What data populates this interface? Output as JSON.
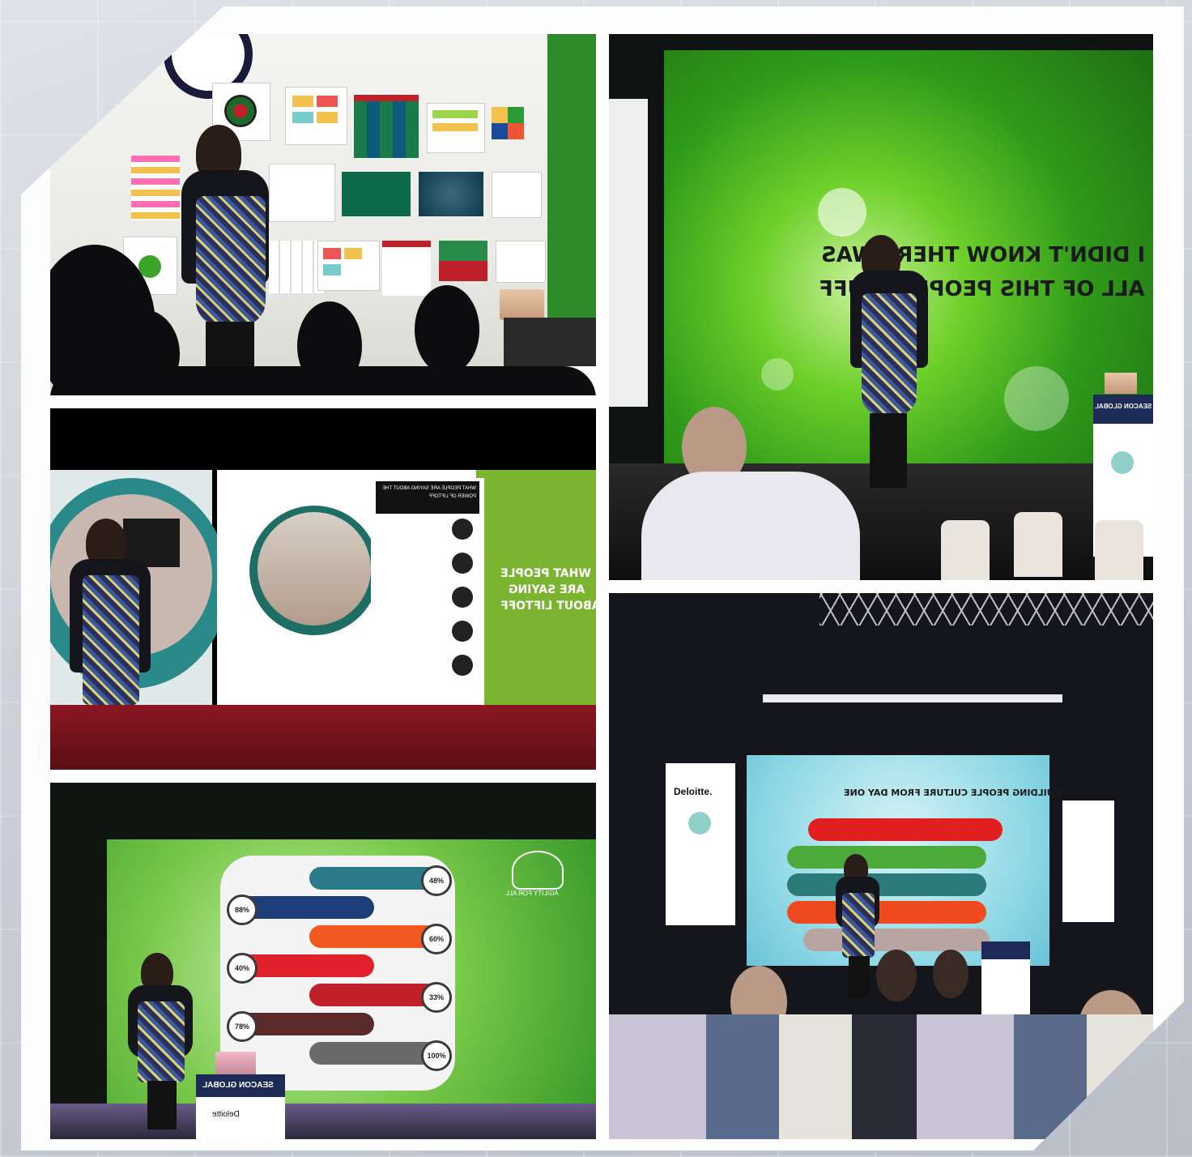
{
  "photos": {
    "p1": {
      "caption": "Presenter in front of a wall of miro boards"
    },
    "p2": {
      "slide_line1": "I DIDN'T KNOW THERE WAS",
      "slide_line2": "ALL OF THIS PEOPLE STUFF",
      "podium": "SEACON GLOBAL"
    },
    "p3": {
      "slide_heading_line1": "WHAT PEOPLE",
      "slide_heading_line2": "ARE SAYING",
      "slide_heading_line3": "ABOUT LIFTOFF",
      "panel_title": "WHAT PEOPLE ARE SAYING ABOUT THE POWER OF LIFTOFF"
    },
    "p4": {
      "slide_title": "BUILDING PEOPLE CULTURE FROM DAY ONE",
      "banner_sponsor": "Deloitte."
    },
    "p5": {
      "badges": [
        "48%",
        "88%",
        "60%",
        "40%",
        "33%",
        "78%",
        "100%"
      ],
      "podium": "SEACON GLOBAL",
      "sponsor": "Deloitte",
      "logo_text": "AGILITY FOR ALL"
    }
  },
  "colors": {
    "green": "#3fa52a",
    "corner": "#22355b",
    "maroon": "#7a1420"
  }
}
